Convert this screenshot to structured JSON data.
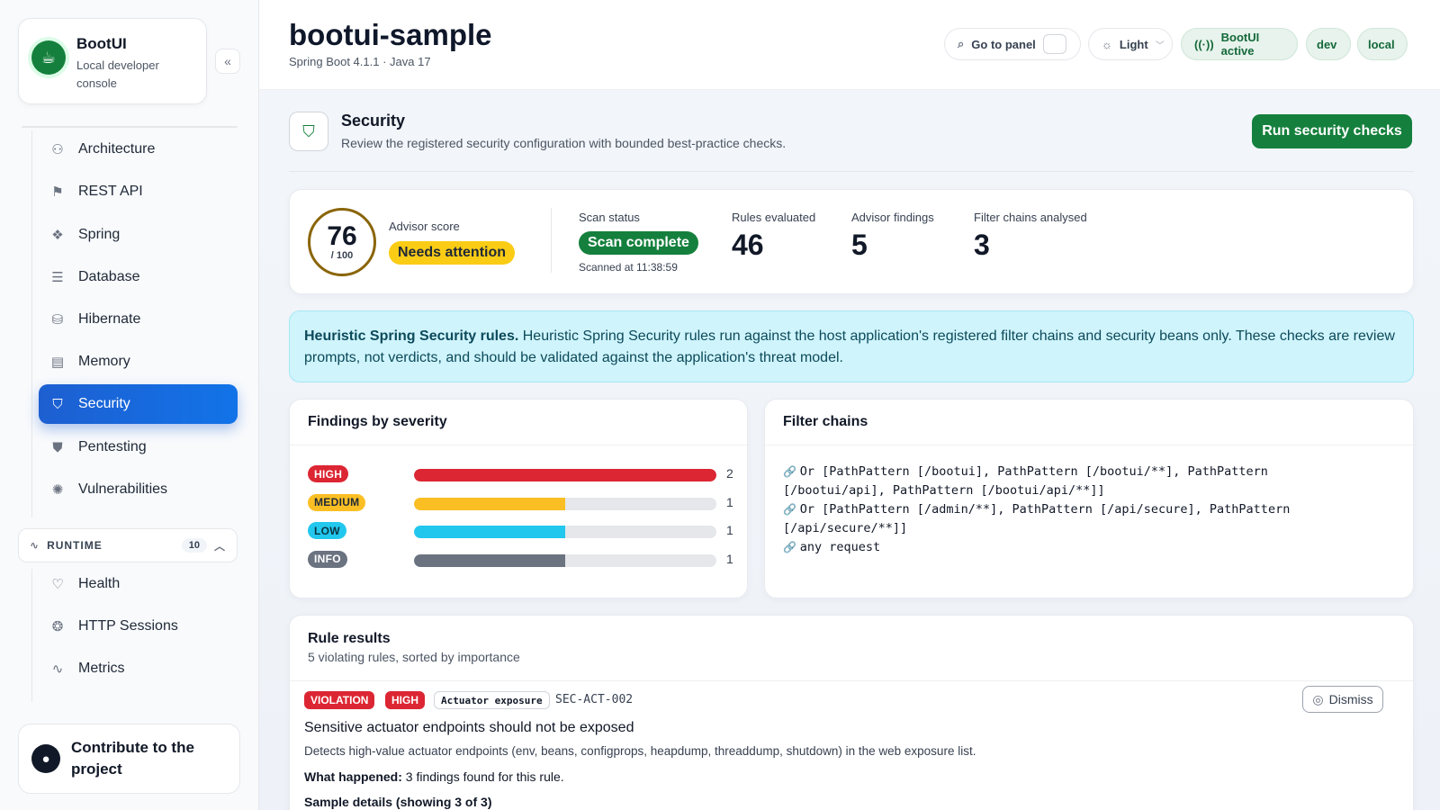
{
  "brand": {
    "title": "BootUI",
    "subtitle_line1": "Local developer",
    "subtitle_line2": "console"
  },
  "nav": {
    "items": [
      {
        "label": "Architecture",
        "icon": "sitemap-icon"
      },
      {
        "label": "REST API",
        "icon": "signpost-icon"
      },
      {
        "label": "Spring",
        "icon": "cubes-icon"
      },
      {
        "label": "Database",
        "icon": "database-icon"
      },
      {
        "label": "Hibernate",
        "icon": "db-cog-icon"
      },
      {
        "label": "Memory",
        "icon": "memory-icon"
      },
      {
        "label": "Security",
        "icon": "shield-icon",
        "active": true
      },
      {
        "label": "Pentesting",
        "icon": "shield-alert-icon"
      },
      {
        "label": "Vulnerabilities",
        "icon": "bug-icon"
      }
    ],
    "runtime": {
      "label": "RUNTIME",
      "count": "10"
    },
    "runtime_items": [
      {
        "label": "Health",
        "icon": "heart-pulse-icon"
      },
      {
        "label": "HTTP Sessions",
        "icon": "cookie-icon"
      },
      {
        "label": "Metrics",
        "icon": "activity-icon"
      }
    ]
  },
  "contribute": {
    "line1": "Contribute to the",
    "line2": "project"
  },
  "topbar": {
    "app_name": "bootui-sample",
    "app_meta": "Spring Boot 4.1.1 · Java 17",
    "goto_label": "Go to panel",
    "theme_label": "Light",
    "active_label": "BootUI active",
    "profile_dev": "dev",
    "profile_local": "local"
  },
  "section": {
    "title": "Security",
    "description": "Review the registered security configuration with bounded best-practice checks.",
    "run_button": "Run security checks"
  },
  "summary": {
    "score": "76",
    "score_denominator": "/ 100",
    "score_label": "Advisor score",
    "score_status": "Needs attention",
    "scan_label": "Scan status",
    "scan_status": "Scan complete",
    "scanned_at": "Scanned at 11:38:59",
    "rules_label": "Rules evaluated",
    "rules_value": "46",
    "findings_label": "Advisor findings",
    "findings_value": "5",
    "chains_label": "Filter chains analysed",
    "chains_value": "3"
  },
  "info": {
    "bold": "Heuristic Spring Security rules.",
    "text": " Heuristic Spring Security rules run against the host application's registered filter chains and security beans only. These checks are review prompts, not verdicts, and should be validated against the application's threat model."
  },
  "severity": {
    "title": "Findings by severity",
    "max": 2,
    "rows": [
      {
        "label": "HIGH",
        "count": 2,
        "color": "#dc2633",
        "text_color": "#ffffff"
      },
      {
        "label": "MEDIUM",
        "count": 1,
        "color": "#fbbf24",
        "text_color": "#1f2937"
      },
      {
        "label": "LOW",
        "count": 1,
        "color": "#22c7ee",
        "text_color": "#0b3340"
      },
      {
        "label": "INFO",
        "count": 1,
        "color": "#6b7280",
        "text_color": "#ffffff"
      }
    ]
  },
  "filter_chains": {
    "title": "Filter chains",
    "lines": [
      {
        "icon": true,
        "text": "Or [PathPattern [/bootui], PathPattern [/bootui/**], PathPattern"
      },
      {
        "icon": false,
        "text": "[/bootui/api], PathPattern [/bootui/api/**]]"
      },
      {
        "icon": true,
        "text": "Or [PathPattern [/admin/**], PathPattern [/api/secure], PathPattern"
      },
      {
        "icon": false,
        "text": "[/api/secure/**]]"
      },
      {
        "icon": true,
        "text": "any request"
      }
    ]
  },
  "rules": {
    "title": "Rule results",
    "subtitle": "5 violating rules, sorted by importance",
    "first": {
      "tag_violation": "VIOLATION",
      "tag_severity": "HIGH",
      "tag_category": "Actuator exposure",
      "id": "SEC-ACT-002",
      "dismiss": "Dismiss",
      "name": "Sensitive actuator endpoints should not be exposed",
      "detect": "Detects high-value actuator endpoints (env, beans, configprops, heapdump, threaddump, shutdown) in the web exposure list.",
      "happened_label": "What happened:",
      "happened_text": " 3 findings found for this rule.",
      "samples": "Sample details (showing 3 of 3)"
    }
  }
}
